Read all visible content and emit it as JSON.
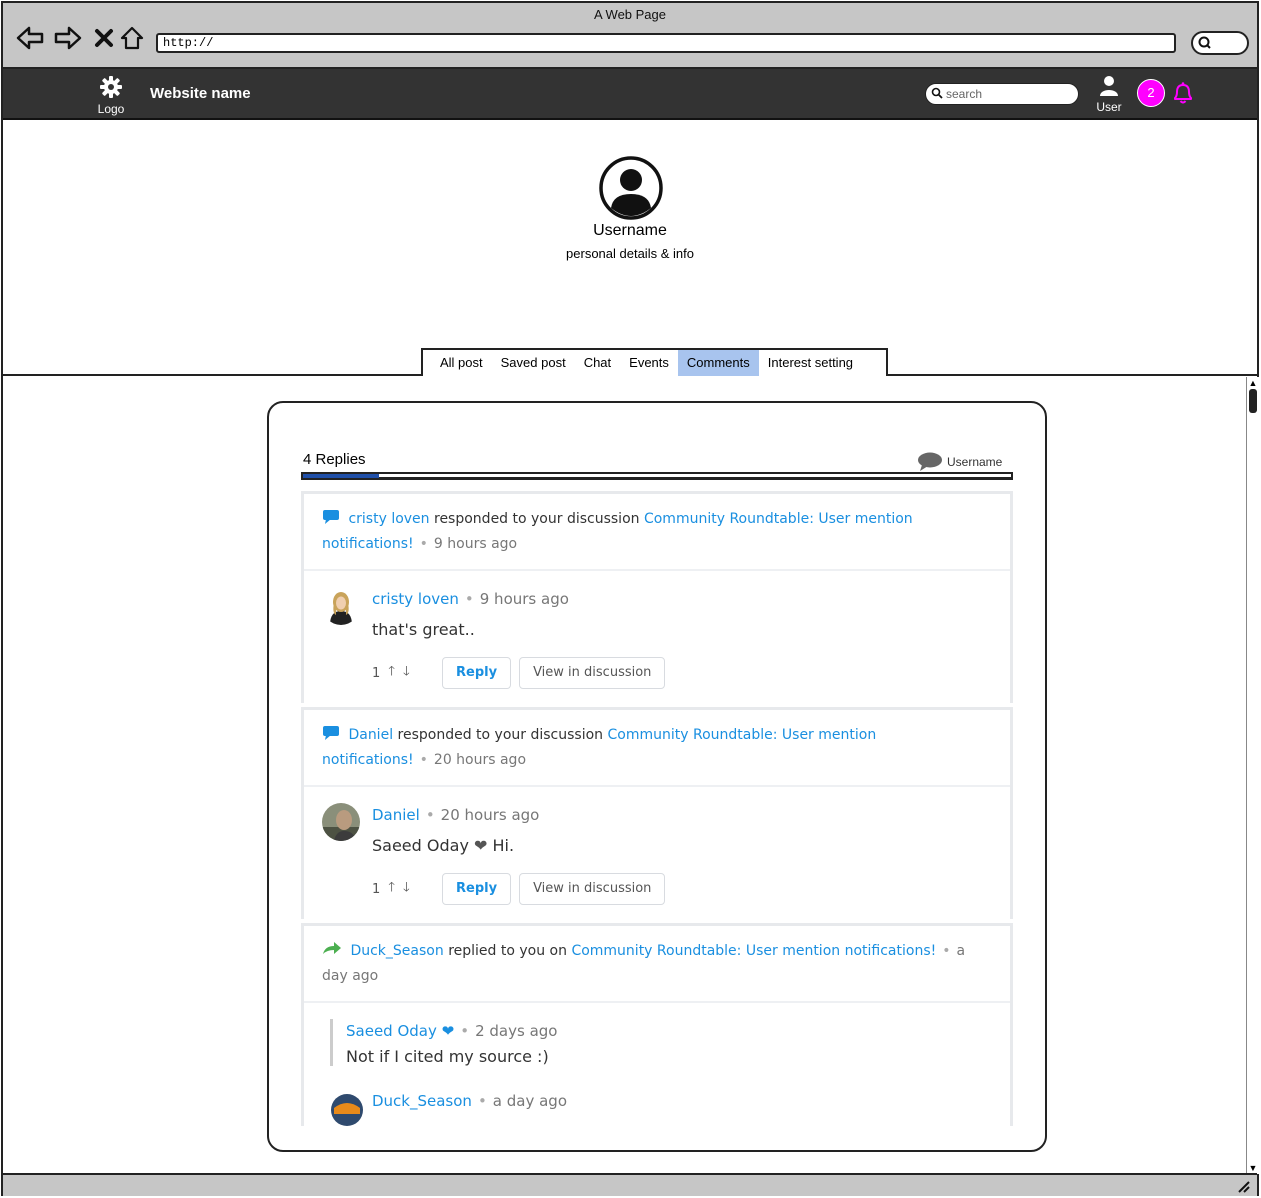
{
  "browser": {
    "window_title": "A Web Page",
    "url": "http://"
  },
  "header": {
    "logo_label": "Logo",
    "site_name": "Website name",
    "search_placeholder": "search",
    "user_label": "User",
    "notification_count": "2"
  },
  "profile": {
    "username": "Username",
    "details": "personal details & info"
  },
  "tabs": [
    {
      "label": "All post"
    },
    {
      "label": "Saved post"
    },
    {
      "label": "Chat"
    },
    {
      "label": "Events"
    },
    {
      "label": "Comments",
      "active": true
    },
    {
      "label": "Interest setting"
    }
  ],
  "replies": {
    "title": "4 Replies",
    "username": "Username"
  },
  "notifications": [
    {
      "actor": "cristy loven",
      "action": "responded to your discussion",
      "topic_part1": "Community Roundtable: User mention",
      "topic_part2": "notifications!",
      "time": "9 hours ago",
      "reply": {
        "author": "cristy loven",
        "time": "9 hours ago",
        "message": "that's great..",
        "votes": "1",
        "reply_label": "Reply",
        "view_label": "View in discussion"
      }
    },
    {
      "actor": "Daniel",
      "action": "responded to your discussion",
      "topic_part1": "Community Roundtable: User mention",
      "topic_part2": "notifications!",
      "time": "20 hours ago",
      "reply": {
        "author": "Daniel",
        "time": "20 hours ago",
        "message_prefix": "Saeed Oday",
        "message_suffix": "Hi.",
        "votes": "1",
        "reply_label": "Reply",
        "view_label": "View in discussion"
      }
    },
    {
      "actor": "Duck_Season",
      "action": "replied to you on",
      "topic": "Community Roundtable: User mention notifications!",
      "time_part1": "a",
      "time_part2": "day ago",
      "quote": {
        "author": "Saeed Oday",
        "time": "2 days ago",
        "message": "Not if I cited my source :)"
      },
      "reply": {
        "author": "Duck_Season",
        "time": "a day ago"
      }
    }
  ],
  "colors": {
    "link": "#1a8fe0",
    "active_tab": "#a8c4ee",
    "badge": "#ff00ff",
    "header_bg": "#333333"
  }
}
